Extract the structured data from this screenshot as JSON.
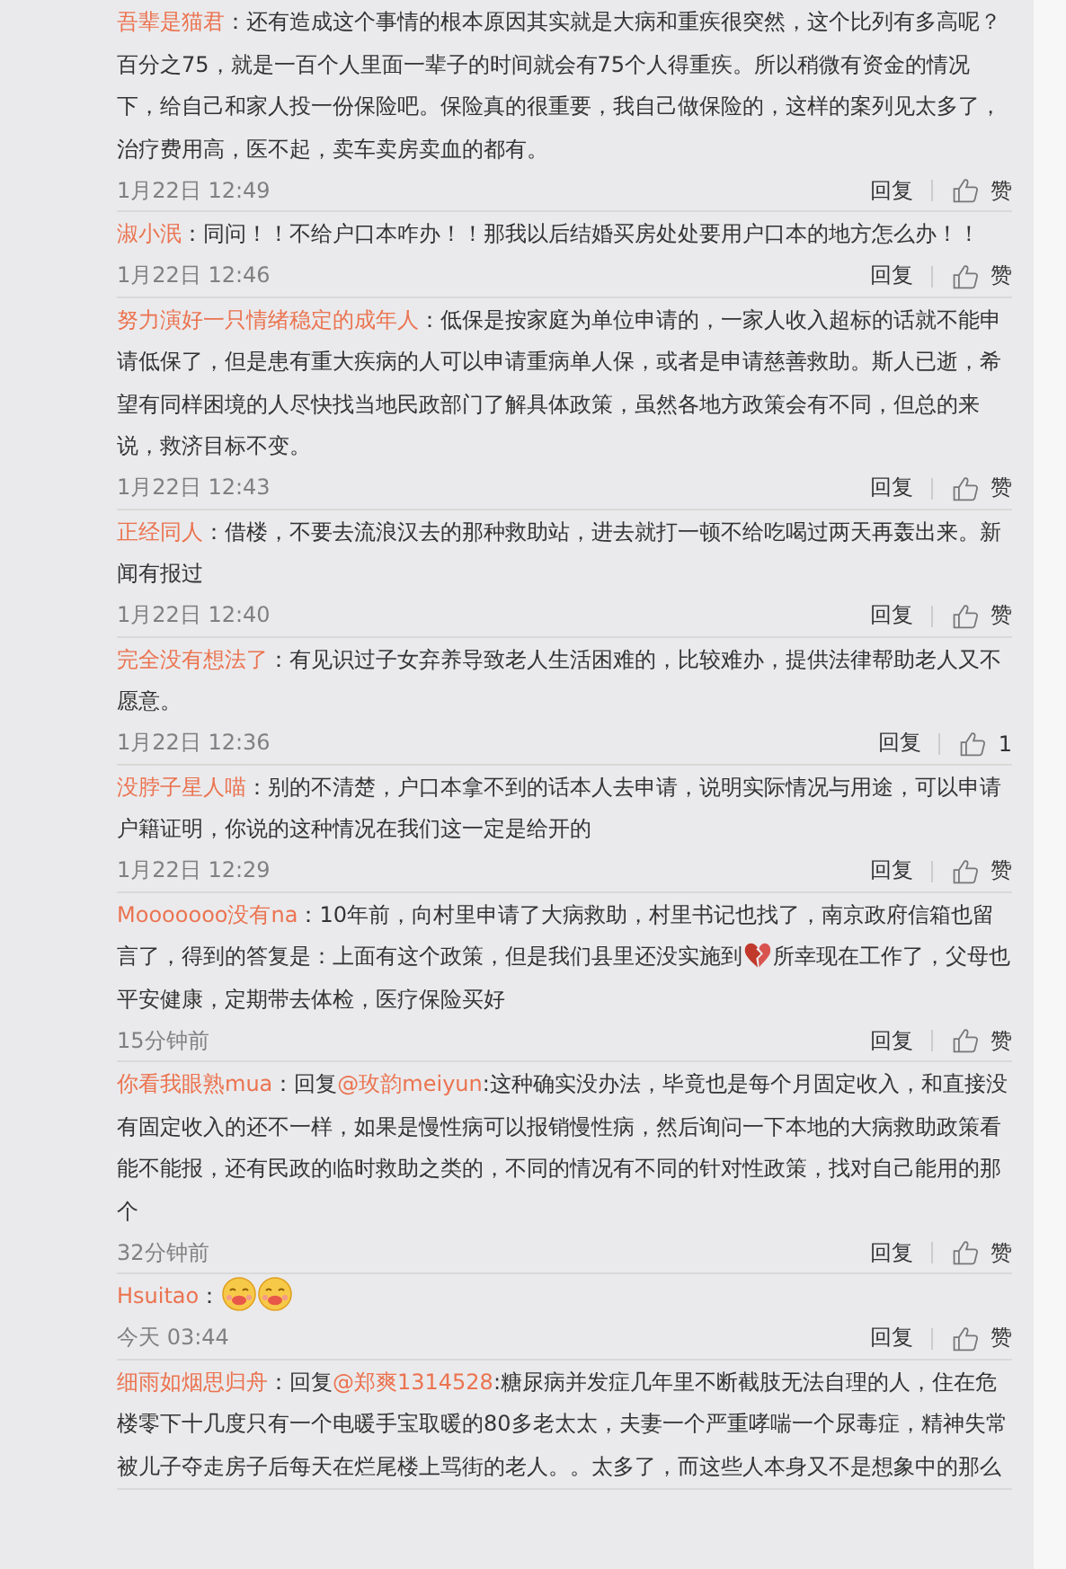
{
  "comments": [
    {
      "name": "吾辈是猫君",
      "parts": [
        {
          "kind": "text",
          "text": "：还有造成这个事情的根本原因其实就是大病和重疾很突然，这个比列有多高呢？百分之75，就是一百个人里面一辈子的时间就会有75个人得重疾。所以稍微有资金的情况下，给自己和家人投一份保险吧。保险真的很重要，我自己做保险的，这样的案列见太多了，治疗费用高，医不起，卖车卖房卖血的都有。"
        }
      ],
      "time": "1月22日 12:49",
      "reply": "回复",
      "likes": "赞"
    },
    {
      "name": "淑小泯",
      "parts": [
        {
          "kind": "text",
          "text": "：同问！！不给户口本咋办！！那我以后结婚买房处处要用户口本的地方怎么办！！"
        }
      ],
      "time": "1月22日 12:46",
      "reply": "回复",
      "likes": "赞"
    },
    {
      "name": "努力演好一只情绪稳定的成年人",
      "parts": [
        {
          "kind": "text",
          "text": "：低保是按家庭为单位申请的，一家人收入超标的话就不能申请低保了，但是患有重大疾病的人可以申请重病单人保，或者是申请慈善救助。斯人已逝，希望有同样困境的人尽快找当地民政部门了解具体政策，虽然各地方政策会有不同，但总的来说，救济目标不变。"
        }
      ],
      "time": "1月22日 12:43",
      "reply": "回复",
      "likes": "赞"
    },
    {
      "name": "正经同人",
      "parts": [
        {
          "kind": "text",
          "text": "：借楼，不要去流浪汉去的那种救助站，进去就打一顿不给吃喝过两天再轰出来。新闻有报过"
        }
      ],
      "time": "1月22日 12:40",
      "reply": "回复",
      "likes": "赞"
    },
    {
      "name": "完全没有想法了",
      "parts": [
        {
          "kind": "text",
          "text": "：有见识过子女弃养导致老人生活困难的，比较难办，提供法律帮助老人又不愿意。"
        }
      ],
      "time": "1月22日 12:36",
      "reply": "回复",
      "likes": "1"
    },
    {
      "name": "没脖子星人喵",
      "parts": [
        {
          "kind": "text",
          "text": "：别的不清楚，户口本拿不到的话本人去申请，说明实际情况与用途，可以申请户籍证明，你说的这种情况在我们这一定是给开的"
        }
      ],
      "time": "1月22日 12:29",
      "reply": "回复",
      "likes": "赞"
    },
    {
      "name": "Mooooooo没有na",
      "parts": [
        {
          "kind": "text",
          "text": "：10年前，向村里申请了大病救助，村里书记也找了，南京政府信箱也留言了，得到的答复是：上面有这个政策，但是我们县里还没实施到"
        },
        {
          "kind": "broken-heart"
        },
        {
          "kind": "text",
          "text": "所幸现在工作了，父母也平安健康，定期带去体检，医疗保险买好"
        }
      ],
      "time": "15分钟前",
      "reply": "回复",
      "likes": "赞"
    },
    {
      "name": "你看我眼熟mua",
      "parts": [
        {
          "kind": "text",
          "text": "：回复"
        },
        {
          "kind": "mention",
          "text": "@玫韵meiyun"
        },
        {
          "kind": "text",
          "text": ":这种确实没办法，毕竟也是每个月固定收入，和直接没有固定收入的还不一样，如果是慢性病可以报销慢性病，然后询问一下本地的大病救助政策看能不能报，还有民政的临时救助之类的，不同的情况有不同的针对性政策，找对自己能用的那个"
        }
      ],
      "time": "32分钟前",
      "reply": "回复",
      "likes": "赞"
    },
    {
      "name": "Hsuitao",
      "parts": [
        {
          "kind": "text",
          "text": "："
        },
        {
          "kind": "smiley"
        },
        {
          "kind": "smiley"
        }
      ],
      "time": "今天 03:44",
      "reply": "回复",
      "likes": "赞"
    },
    {
      "name": "细雨如烟思归舟",
      "parts": [
        {
          "kind": "text",
          "text": "：回复"
        },
        {
          "kind": "mention",
          "text": "@郑爽1314528"
        },
        {
          "kind": "text",
          "text": ":糖尿病并发症几年里不断截肢无法自理的人，住在危楼零下十几度只有一个电暖手宝取暖的80多老太太，夫妻一个严重哮喘一个尿毒症，精神失常被儿子夺走房子后每天在烂尾楼上骂街的老人。。太多了，而这些人本身又不是想象中的那么"
        }
      ]
    }
  ]
}
